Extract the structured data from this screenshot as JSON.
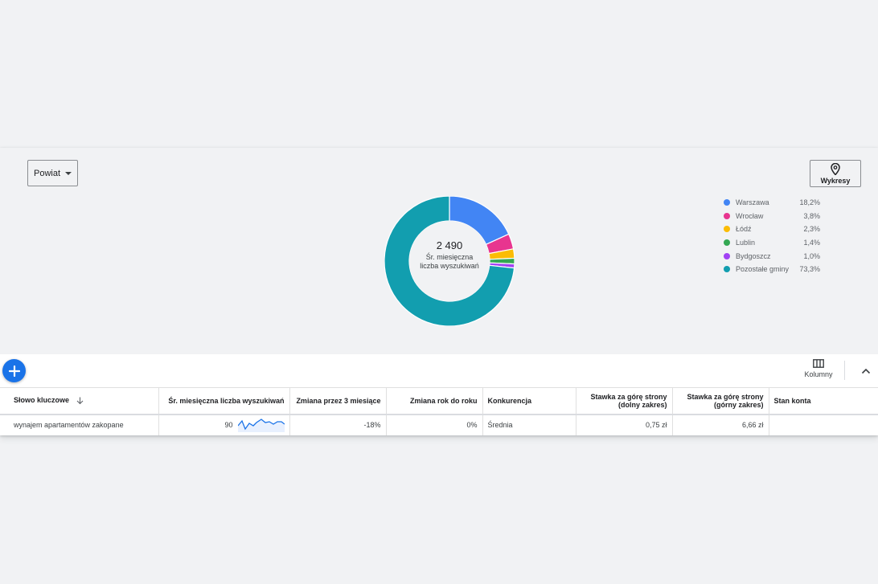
{
  "filter": {
    "selected": "Powiat"
  },
  "charts_button": {
    "label": "Wykresy",
    "icon": "location-pin-icon"
  },
  "donut": {
    "total": "2 490",
    "caption": "Śr. miesięczna liczba wyszukiwań"
  },
  "chart_data": {
    "type": "pie",
    "categories": [
      "Warszawa",
      "Wrocław",
      "Łódź",
      "Lublin",
      "Bydgoszcz",
      "Pozostałe gminy"
    ],
    "values": [
      18.2,
      3.8,
      2.3,
      1.4,
      1.0,
      73.3
    ],
    "colors": [
      "#4285f4",
      "#e8358f",
      "#fbbc04",
      "#34a853",
      "#a142f4",
      "#129eaf"
    ],
    "legend_placement": "right"
  },
  "legend": [
    {
      "name": "Warszawa",
      "value": "18,2%",
      "color": "#4285f4"
    },
    {
      "name": "Wrocław",
      "value": "3,8%",
      "color": "#e8358f"
    },
    {
      "name": "Łódź",
      "value": "2,3%",
      "color": "#fbbc04"
    },
    {
      "name": "Lublin",
      "value": "1,4%",
      "color": "#34a853"
    },
    {
      "name": "Bydgoszcz",
      "value": "1,0%",
      "color": "#a142f4"
    },
    {
      "name": "Pozostałe gminy",
      "value": "73,3%",
      "color": "#129eaf"
    }
  ],
  "toolbar": {
    "add_icon": "plus-icon",
    "columns_label": "Kolumny",
    "columns_icon": "columns-icon",
    "collapse_icon": "chevron-up-icon"
  },
  "table": {
    "headers": {
      "keyword": "Słowo kluczowe",
      "avg_searches": "Śr. miesięczna liczba wyszukiwań",
      "change_3m": "Zmiana przez 3 miesiące",
      "change_yoy": "Zmiana rok do roku",
      "competition": "Konkurencja",
      "bid_low_1": "Stawka za górę strony",
      "bid_low_2": "(dolny zakres)",
      "bid_high_1": "Stawka za górę strony",
      "bid_high_2": "(górny zakres)",
      "account_status": "Stan konta"
    },
    "rows": [
      {
        "keyword": "wynajem apartamentów zakopane",
        "avg_searches": "90",
        "change_3m": "-18%",
        "change_yoy": "0%",
        "competition": "Średnia",
        "bid_low": "0,75 zł",
        "bid_high": "6,66 zł",
        "account_status": ""
      }
    ]
  },
  "colors": {
    "accent": "#1a73e8",
    "sparkline": "#1a73e8"
  }
}
